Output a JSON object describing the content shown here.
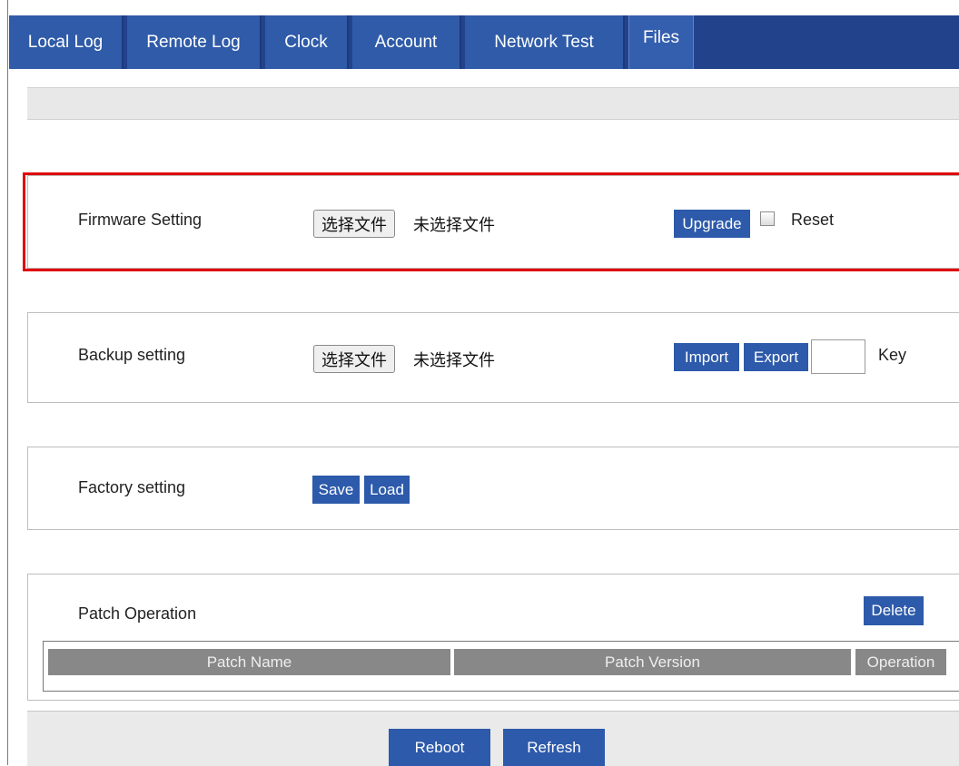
{
  "tabs": [
    {
      "label": "Local Log"
    },
    {
      "label": "Remote Log"
    },
    {
      "label": "Clock"
    },
    {
      "label": "Account"
    },
    {
      "label": "Network Test"
    },
    {
      "label": "Files",
      "active": true
    }
  ],
  "firmware": {
    "label": "Firmware Setting",
    "choose_file": "选择文件",
    "no_file": "未选择文件",
    "upgrade": "Upgrade",
    "reset_label": "Reset",
    "reset_checked": false
  },
  "backup": {
    "label": "Backup setting",
    "choose_file": "选择文件",
    "no_file": "未选择文件",
    "import": "Import",
    "export": "Export",
    "key_value": "",
    "key_label": "Key"
  },
  "factory": {
    "label": "Factory setting",
    "save": "Save",
    "load": "Load"
  },
  "patch": {
    "label": "Patch Operation",
    "delete": "Delete",
    "columns": [
      "Patch Name",
      "Patch Version",
      "Operation"
    ]
  },
  "footer": {
    "reboot": "Reboot",
    "refresh": "Refresh"
  },
  "colors": {
    "tab_bar": "#22438c",
    "button_blue": "#2d5aaa",
    "highlight": "#e00000",
    "table_header": "#888888"
  }
}
